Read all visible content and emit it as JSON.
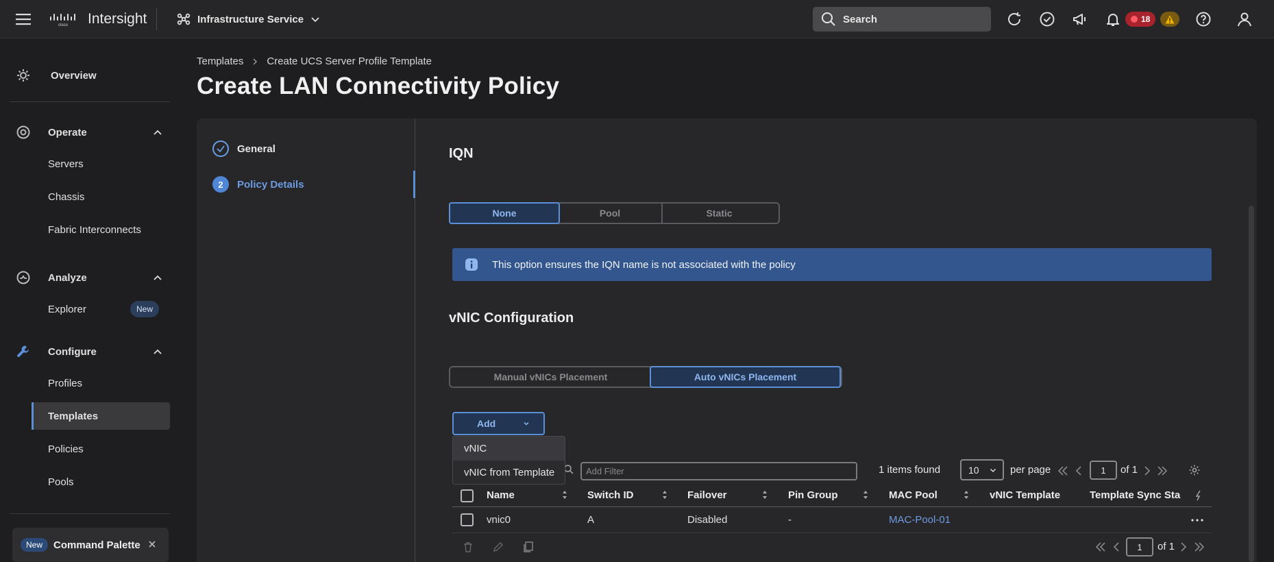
{
  "topbar": {
    "app_name": "Intersight",
    "service": "Infrastructure Service",
    "search_placeholder": "Search",
    "alarm_count": "18"
  },
  "sidebar": {
    "overview": "Overview",
    "operate": "Operate",
    "operate_items": [
      "Servers",
      "Chassis",
      "Fabric Interconnects"
    ],
    "analyze": "Analyze",
    "explorer": "Explorer",
    "explorer_badge": "New",
    "configure": "Configure",
    "configure_items": [
      "Profiles",
      "Templates",
      "Policies",
      "Pools"
    ],
    "active_item": "Templates",
    "command_palette": {
      "badge": "New",
      "label": "Command Palette"
    }
  },
  "breadcrumb": [
    "Templates",
    "Create UCS Server Profile Template"
  ],
  "page_title": "Create LAN Connectivity Policy",
  "steps": [
    {
      "num": "1",
      "label": "General",
      "status": "done"
    },
    {
      "num": "2",
      "label": "Policy Details",
      "status": "current"
    }
  ],
  "iqn": {
    "title": "IQN",
    "options": [
      "None",
      "Pool",
      "Static"
    ],
    "selected": "None",
    "info": "This option ensures the IQN name is not associated with the policy"
  },
  "vnic": {
    "title": "vNIC Configuration",
    "placement_options": [
      "Manual vNICs Placement",
      "Auto vNICs Placement"
    ],
    "selected": "Auto vNICs Placement",
    "add_label": "Add",
    "add_menu": [
      "vNIC",
      "vNIC from Template"
    ]
  },
  "table": {
    "filter_placeholder": "Add Filter",
    "items_found": "1 items found",
    "per_page_value": "10",
    "per_page_label": "per page",
    "page": "1",
    "of_pages": "of 1",
    "columns": [
      "Name",
      "Switch ID",
      "Failover",
      "Pin Group",
      "MAC Pool",
      "vNIC Template",
      "Template Sync Sta"
    ],
    "rows": [
      {
        "name": "vnic0",
        "switch_id": "A",
        "failover": "Disabled",
        "pin_group": "-",
        "mac_pool": "MAC-Pool-01",
        "vnic_template": "",
        "template_sync": ""
      }
    ],
    "footer_page": "1",
    "footer_of": "of 1"
  },
  "colors": {
    "accent": "#5b8fd6",
    "info_banner": "#34568e",
    "alarm_critical": "#a8232c",
    "alarm_warning": "#7a5b12"
  }
}
